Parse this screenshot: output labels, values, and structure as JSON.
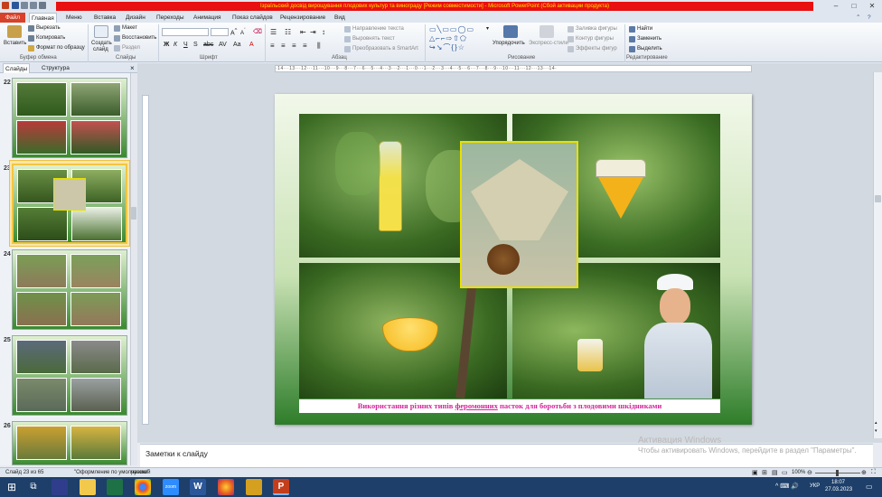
{
  "window": {
    "title": "Ізраїльский досвід вирощування плодових культур та винограду [Режим совместимости] - Microsoft PowerPoint (Сбой активации продукта)",
    "controls": [
      "–",
      "□",
      "✕"
    ]
  },
  "ribbon_tabs": [
    "Файл",
    "Главная",
    "Меню",
    "Вставка",
    "Дизайн",
    "Переходы",
    "Анимация",
    "Показ слайдов",
    "Рецензирование",
    "Вид"
  ],
  "ribbon": {
    "clipboard": {
      "paste": "Вставить",
      "cut": "Вырезать",
      "copy": "Копировать",
      "format": "Формат по образцу",
      "group": "Буфер обмена"
    },
    "slides": {
      "create": "Создать",
      "create2": "слайд",
      "layout": "Макет",
      "reset": "Восстановить",
      "section": "Раздел",
      "group": "Слайды"
    },
    "font": {
      "group": "Шрифт"
    },
    "paragraph": {
      "dir": "Направление текста",
      "align": "Выровнять текст",
      "smartart": "Преобразовать в SmartArt",
      "group": "Абзац"
    },
    "drawing": {
      "arrange": "Упорядочить",
      "styles": "Экспресс-стили",
      "fill": "Заливка фигуры",
      "outline": "Контур фигуры",
      "effects": "Эффекты фигур",
      "group": "Рисование"
    },
    "editing": {
      "find": "Найти",
      "replace": "Заменить",
      "select": "Выделить",
      "group": "Редактирование"
    }
  },
  "panel_tabs": [
    "Слайды",
    "Структура"
  ],
  "panel_close": "×",
  "thumbnails": [
    {
      "num": "22"
    },
    {
      "num": "23",
      "selected": true
    },
    {
      "num": "24"
    },
    {
      "num": "25"
    },
    {
      "num": "26"
    }
  ],
  "ruler_text": "·14·⋅·13·⋅·12·⋅·11·⋅·10·⋅·9·⋅·8·⋅·7·⋅·6·⋅·5·⋅·4·⋅·3·⋅·2·⋅·1·⋅·0·⋅·1·⋅·2·⋅·3·⋅·4·⋅·5·⋅·6·⋅·7·⋅·8·⋅·9·⋅·10·⋅·11·⋅·12·⋅·13·⋅·14·",
  "slide": {
    "caption_before": "Використання різних типів ",
    "caption_link": "феромонних",
    "caption_after": " пасток  для боротьби з плодовими шкідниками"
  },
  "notes": {
    "placeholder": "Заметки к слайду"
  },
  "activation": {
    "line1": "Активация Windows",
    "line2": "Чтобы активировать Windows, перейдите в раздел \"Параметры\"."
  },
  "status": {
    "slide": "Слайд 23 из 65",
    "theme": "\"Оформление по умолчанию\"",
    "lang": "русский",
    "zoom": "100%"
  },
  "taskbar": {
    "lang": "УКР",
    "time": "18:07",
    "date": "27.03.2023"
  },
  "colors": {
    "accent_red": "#e81010",
    "caption_pink": "#d6249c",
    "slide_green": "#2e7d2a"
  }
}
